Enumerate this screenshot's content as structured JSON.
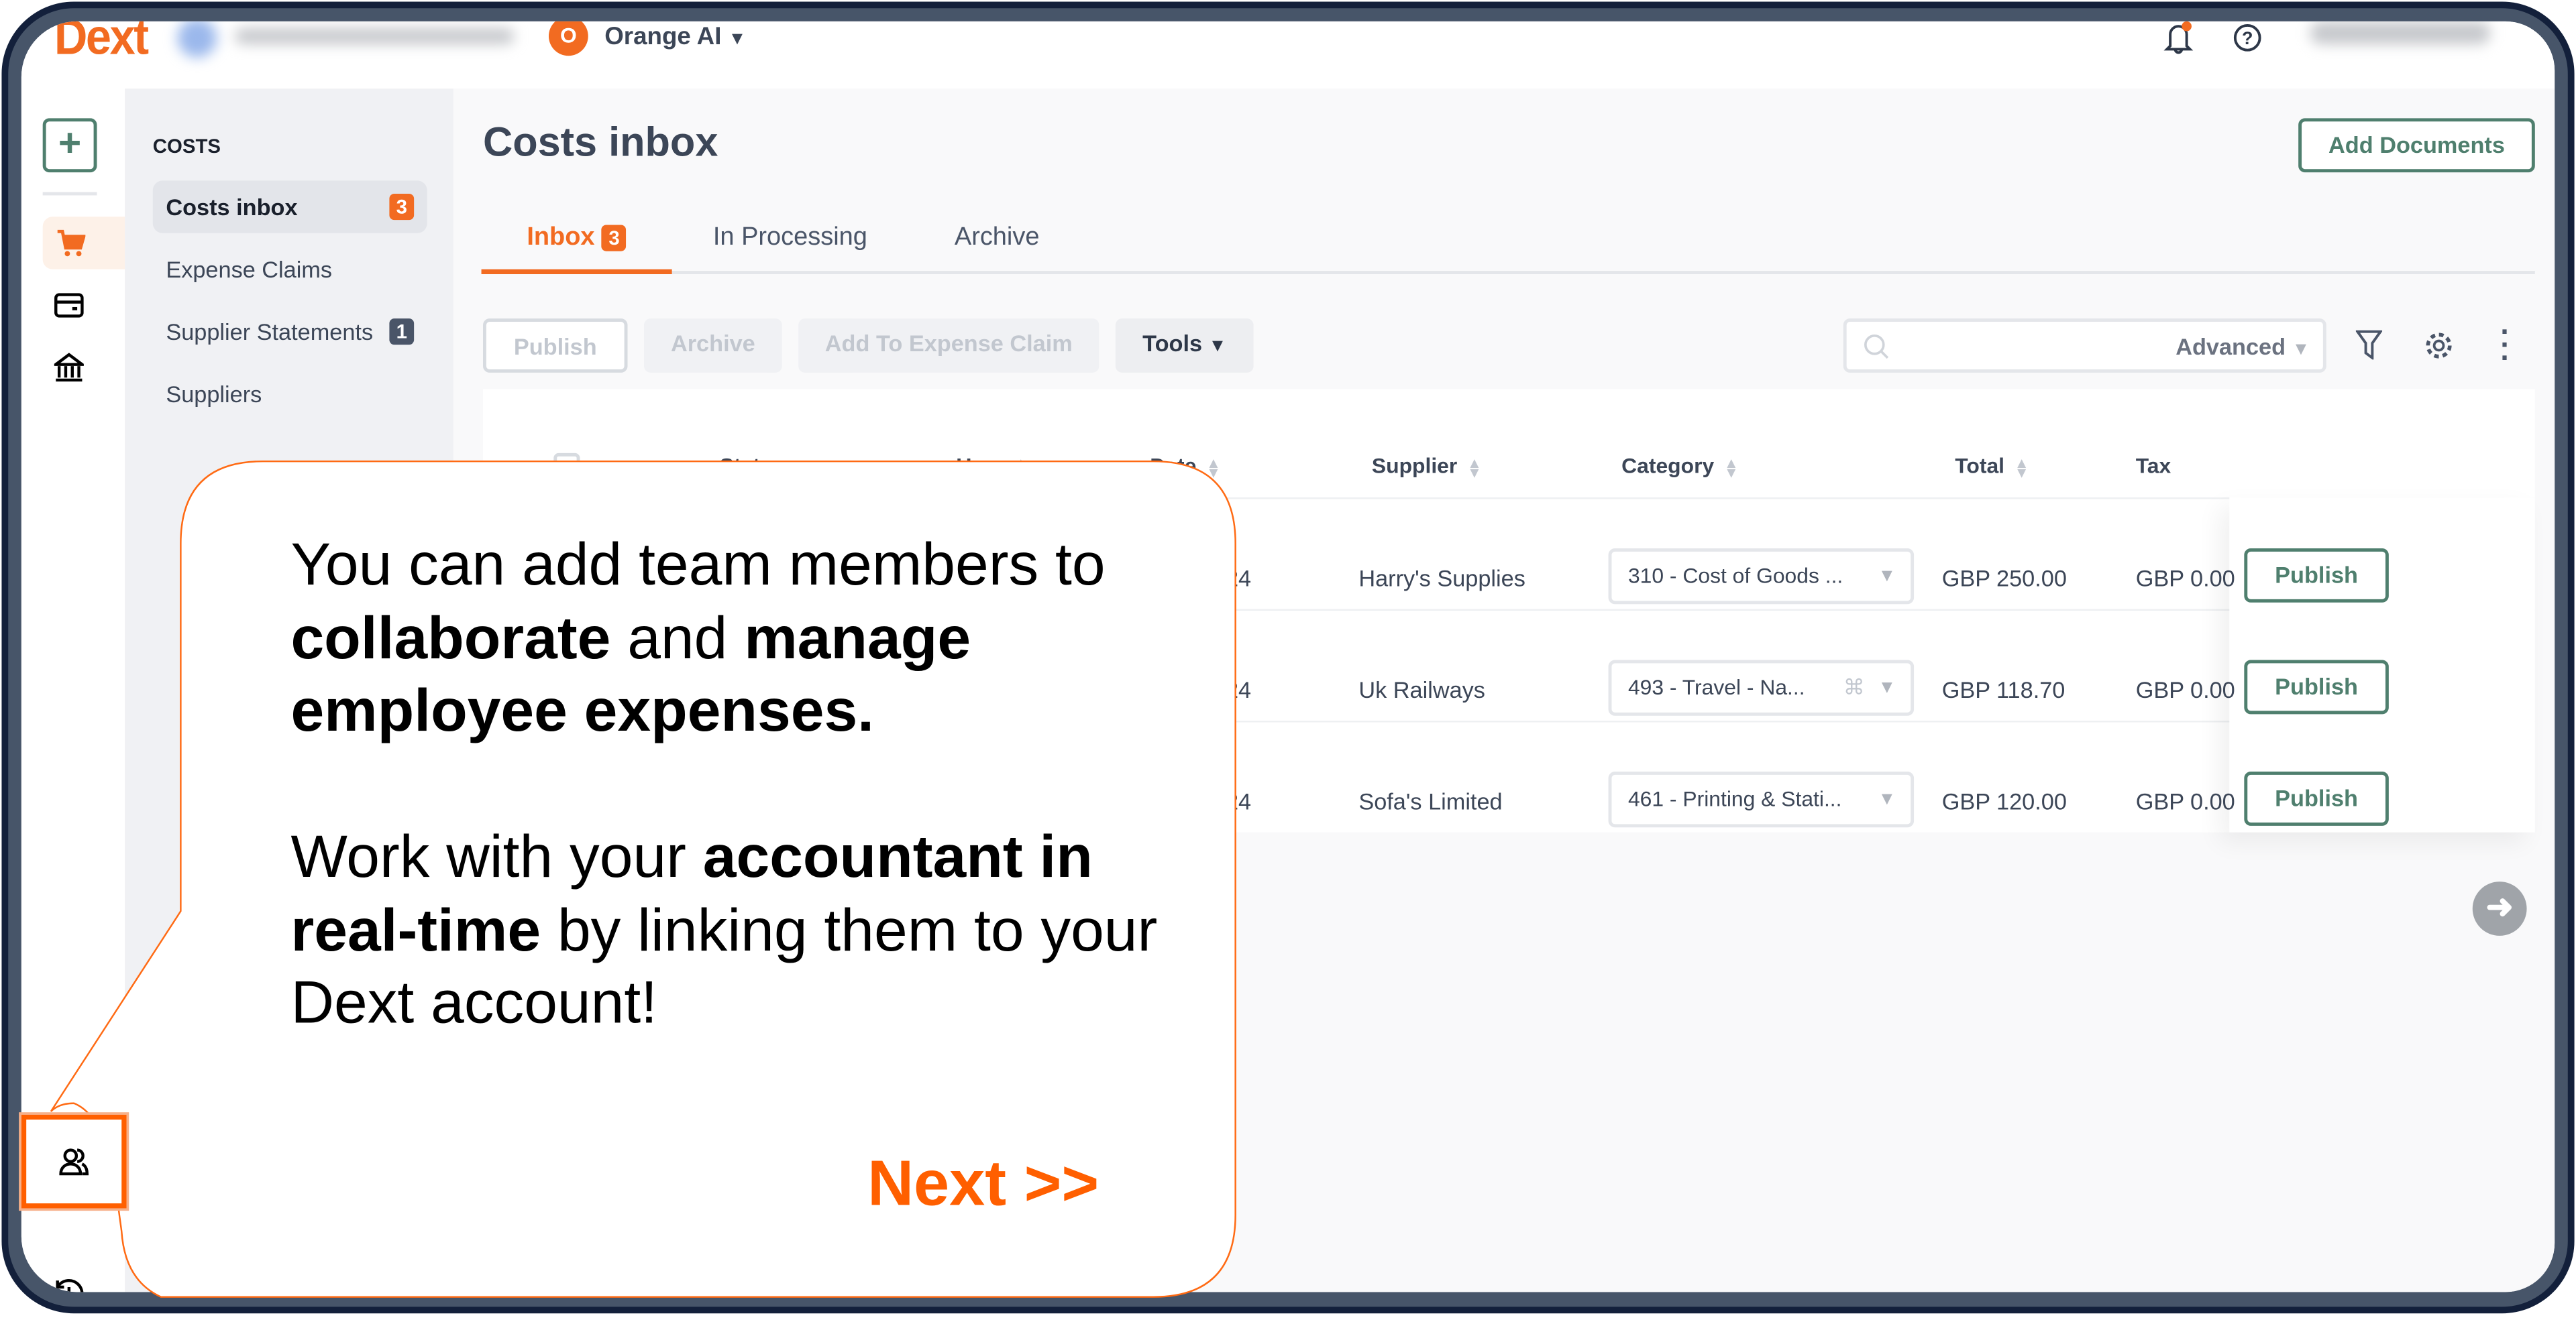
{
  "app": {
    "logo": "Dext",
    "org_initial": "O",
    "org_name": "Orange AI"
  },
  "colors": {
    "brand_orange": "#f26b21",
    "accent_green": "#4f7f6e",
    "highlight": "#ff5f00"
  },
  "rail": {
    "icons": [
      "plus-icon",
      "cart-icon",
      "card-icon",
      "bank-icon",
      "users-icon",
      "history-icon",
      "settings-icon"
    ]
  },
  "sidebar": {
    "section": "COSTS",
    "items": [
      {
        "label": "Costs inbox",
        "badge": "3"
      },
      {
        "label": "Expense Claims"
      },
      {
        "label": "Supplier Statements",
        "badge": "1"
      },
      {
        "label": "Suppliers"
      }
    ]
  },
  "main": {
    "title": "Costs inbox",
    "add_documents": "Add Documents",
    "tabs": [
      {
        "label": "Inbox",
        "badge": "3"
      },
      {
        "label": "In Processing"
      },
      {
        "label": "Archive"
      }
    ],
    "toolbar": {
      "publish": "Publish",
      "archive": "Archive",
      "add_to_claim": "Add To Expense Claim",
      "tools": "Tools",
      "search_placeholder": "",
      "advanced": "Advanced"
    },
    "table": {
      "headers": [
        "Status",
        "User",
        "Date",
        "Supplier",
        "Category",
        "Total",
        "Tax"
      ],
      "rows": [
        {
          "date": "24",
          "supplier": "Harry's Supplies",
          "category": "310 - Cost of Goods ...",
          "total": "GBP 250.00",
          "tax": "GBP 0.00",
          "action": "Publish"
        },
        {
          "date": "24",
          "supplier": "Uk Railways",
          "category": "493 - Travel - Na...",
          "total": "GBP 118.70",
          "tax": "GBP 0.00",
          "action": "Publish"
        },
        {
          "date": "24",
          "supplier": "Sofa's Limited",
          "category": "461 - Printing & Stati...",
          "total": "GBP 120.00",
          "tax": "GBP 0.00",
          "action": "Publish"
        }
      ]
    }
  },
  "tooltip": {
    "p1": [
      "You can add team members to ",
      "collaborate",
      " and ",
      "manage employee expenses."
    ],
    "p2": [
      "Work with your ",
      "accountant in real-time",
      " by linking them to your Dext account!"
    ],
    "next": "Next >>"
  }
}
